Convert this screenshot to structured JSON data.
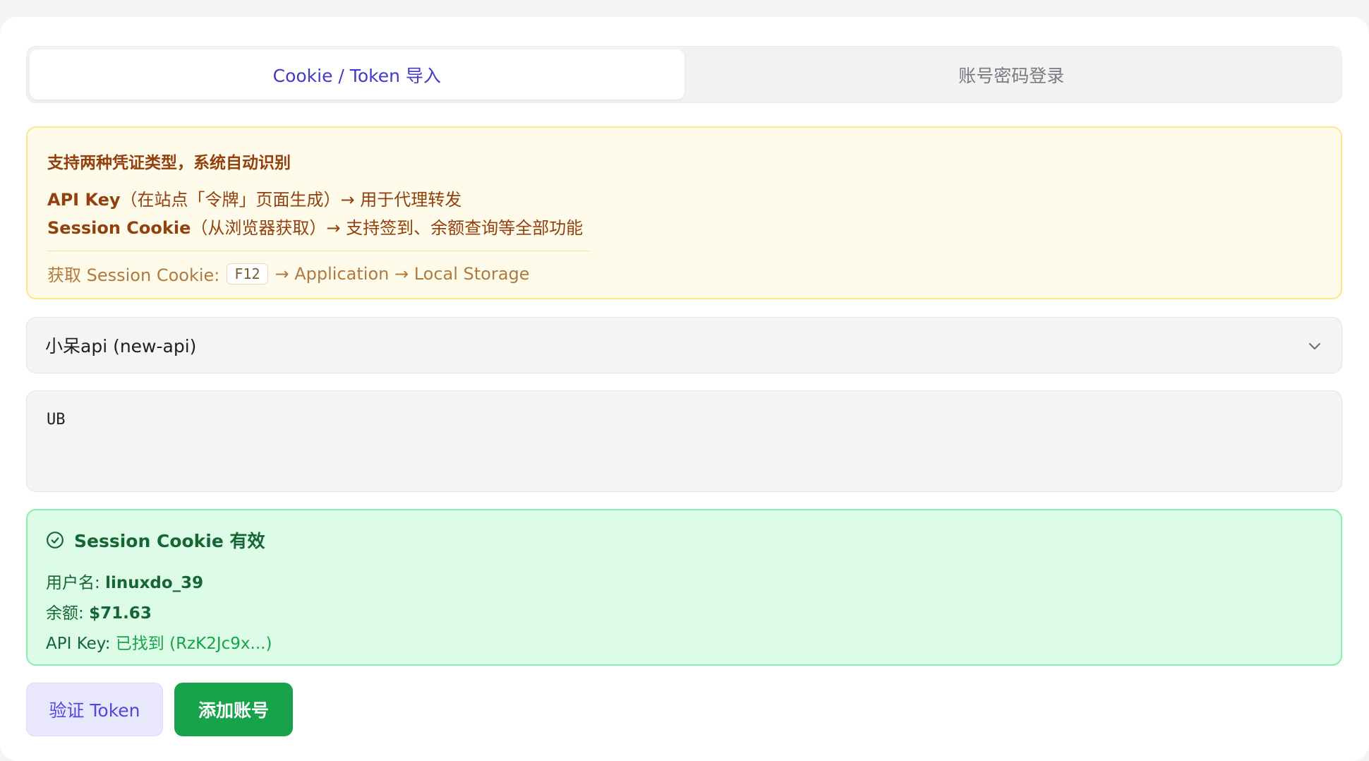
{
  "tabs": {
    "cookie_token": "Cookie / Token 导入",
    "password_login": "账号密码登录"
  },
  "notice": {
    "title": "支持两种凭证类型，系统自动识别",
    "api_key_label": "API Key",
    "api_key_desc": "（在站点「令牌」页面生成）→ 用于代理转发",
    "session_label": "Session Cookie",
    "session_desc": "（从浏览器获取）→ 支持签到、余额查询等全部功能",
    "hint_prefix": "获取 Session Cookie:",
    "hint_key": "F12",
    "hint_suffix": "→ Application → Local Storage"
  },
  "site_select": {
    "value": "小呆api (new-api)"
  },
  "token_input": {
    "value": "UB"
  },
  "result": {
    "title": "Session Cookie 有效",
    "username_label": "用户名:",
    "username_value": "linuxdo_39",
    "balance_label": "余额:",
    "balance_value": "$71.63",
    "apikey_label": "API Key:",
    "apikey_value": "已找到 (RzK2Jc9x...)"
  },
  "buttons": {
    "verify": "验证 Token",
    "add": "添加账号"
  },
  "colors": {
    "accent": "#4f46e5",
    "success": "#16a34a",
    "warning_bg": "#fffbeb",
    "success_bg": "#dcfce7"
  },
  "icons": {
    "select_chevron": "chevron-down-icon",
    "result_status": "check-circle-icon"
  }
}
